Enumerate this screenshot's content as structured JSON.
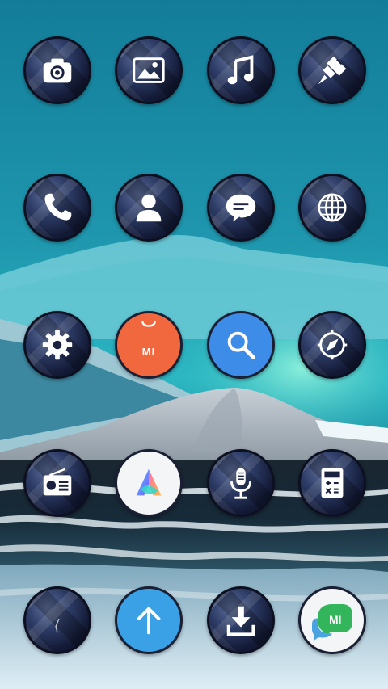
{
  "screen": {
    "colors": {
      "sky_top": "#1a8aa5",
      "sky_mid": "#27a9bd",
      "glow": "#6ee3d6",
      "water_dark": "#0f1c26",
      "shore": "#cfe3ee"
    }
  },
  "apps": [
    {
      "name": "camera",
      "icon": "camera-icon"
    },
    {
      "name": "gallery",
      "icon": "image-icon"
    },
    {
      "name": "music",
      "icon": "music-note-icon"
    },
    {
      "name": "themes",
      "icon": "paint-brush-icon"
    },
    {
      "name": "phone",
      "icon": "phone-icon"
    },
    {
      "name": "contacts",
      "icon": "person-icon"
    },
    {
      "name": "messages",
      "icon": "chat-bubble-icon"
    },
    {
      "name": "browser",
      "icon": "globe-icon"
    },
    {
      "name": "settings",
      "icon": "gear-icon"
    },
    {
      "name": "mi-store",
      "icon": "mi-bag-icon",
      "label": "MI"
    },
    {
      "name": "search",
      "icon": "search-icon"
    },
    {
      "name": "compass",
      "icon": "compass-icon"
    },
    {
      "name": "fm-radio",
      "icon": "radio-icon"
    },
    {
      "name": "app-vault",
      "icon": "app-vault-logo-icon"
    },
    {
      "name": "recorder",
      "icon": "microphone-icon"
    },
    {
      "name": "calculator",
      "icon": "calculator-icon"
    },
    {
      "name": "unknown-app",
      "icon": "blank-icon"
    },
    {
      "name": "updater",
      "icon": "arrow-up-icon"
    },
    {
      "name": "downloads",
      "icon": "download-icon"
    },
    {
      "name": "mi-chat",
      "icon": "mi-chat-icon",
      "label": "MI"
    }
  ]
}
